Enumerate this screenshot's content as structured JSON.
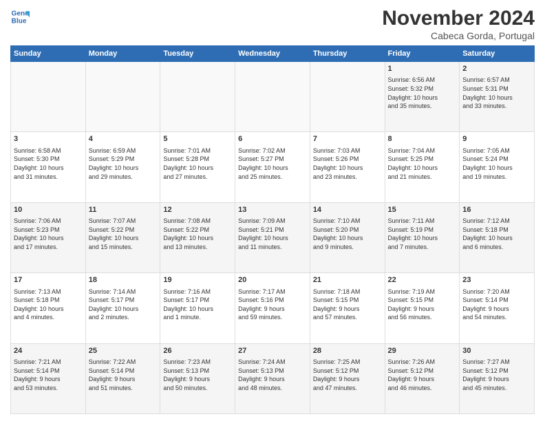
{
  "logo": {
    "line1": "General",
    "line2": "Blue"
  },
  "title": "November 2024",
  "location": "Cabeca Gorda, Portugal",
  "days_header": [
    "Sunday",
    "Monday",
    "Tuesday",
    "Wednesday",
    "Thursday",
    "Friday",
    "Saturday"
  ],
  "weeks": [
    [
      {
        "day": "",
        "data": ""
      },
      {
        "day": "",
        "data": ""
      },
      {
        "day": "",
        "data": ""
      },
      {
        "day": "",
        "data": ""
      },
      {
        "day": "",
        "data": ""
      },
      {
        "day": "1",
        "data": "Sunrise: 6:56 AM\nSunset: 5:32 PM\nDaylight: 10 hours\nand 35 minutes."
      },
      {
        "day": "2",
        "data": "Sunrise: 6:57 AM\nSunset: 5:31 PM\nDaylight: 10 hours\nand 33 minutes."
      }
    ],
    [
      {
        "day": "3",
        "data": "Sunrise: 6:58 AM\nSunset: 5:30 PM\nDaylight: 10 hours\nand 31 minutes."
      },
      {
        "day": "4",
        "data": "Sunrise: 6:59 AM\nSunset: 5:29 PM\nDaylight: 10 hours\nand 29 minutes."
      },
      {
        "day": "5",
        "data": "Sunrise: 7:01 AM\nSunset: 5:28 PM\nDaylight: 10 hours\nand 27 minutes."
      },
      {
        "day": "6",
        "data": "Sunrise: 7:02 AM\nSunset: 5:27 PM\nDaylight: 10 hours\nand 25 minutes."
      },
      {
        "day": "7",
        "data": "Sunrise: 7:03 AM\nSunset: 5:26 PM\nDaylight: 10 hours\nand 23 minutes."
      },
      {
        "day": "8",
        "data": "Sunrise: 7:04 AM\nSunset: 5:25 PM\nDaylight: 10 hours\nand 21 minutes."
      },
      {
        "day": "9",
        "data": "Sunrise: 7:05 AM\nSunset: 5:24 PM\nDaylight: 10 hours\nand 19 minutes."
      }
    ],
    [
      {
        "day": "10",
        "data": "Sunrise: 7:06 AM\nSunset: 5:23 PM\nDaylight: 10 hours\nand 17 minutes."
      },
      {
        "day": "11",
        "data": "Sunrise: 7:07 AM\nSunset: 5:22 PM\nDaylight: 10 hours\nand 15 minutes."
      },
      {
        "day": "12",
        "data": "Sunrise: 7:08 AM\nSunset: 5:22 PM\nDaylight: 10 hours\nand 13 minutes."
      },
      {
        "day": "13",
        "data": "Sunrise: 7:09 AM\nSunset: 5:21 PM\nDaylight: 10 hours\nand 11 minutes."
      },
      {
        "day": "14",
        "data": "Sunrise: 7:10 AM\nSunset: 5:20 PM\nDaylight: 10 hours\nand 9 minutes."
      },
      {
        "day": "15",
        "data": "Sunrise: 7:11 AM\nSunset: 5:19 PM\nDaylight: 10 hours\nand 7 minutes."
      },
      {
        "day": "16",
        "data": "Sunrise: 7:12 AM\nSunset: 5:18 PM\nDaylight: 10 hours\nand 6 minutes."
      }
    ],
    [
      {
        "day": "17",
        "data": "Sunrise: 7:13 AM\nSunset: 5:18 PM\nDaylight: 10 hours\nand 4 minutes."
      },
      {
        "day": "18",
        "data": "Sunrise: 7:14 AM\nSunset: 5:17 PM\nDaylight: 10 hours\nand 2 minutes."
      },
      {
        "day": "19",
        "data": "Sunrise: 7:16 AM\nSunset: 5:17 PM\nDaylight: 10 hours\nand 1 minute."
      },
      {
        "day": "20",
        "data": "Sunrise: 7:17 AM\nSunset: 5:16 PM\nDaylight: 9 hours\nand 59 minutes."
      },
      {
        "day": "21",
        "data": "Sunrise: 7:18 AM\nSunset: 5:15 PM\nDaylight: 9 hours\nand 57 minutes."
      },
      {
        "day": "22",
        "data": "Sunrise: 7:19 AM\nSunset: 5:15 PM\nDaylight: 9 hours\nand 56 minutes."
      },
      {
        "day": "23",
        "data": "Sunrise: 7:20 AM\nSunset: 5:14 PM\nDaylight: 9 hours\nand 54 minutes."
      }
    ],
    [
      {
        "day": "24",
        "data": "Sunrise: 7:21 AM\nSunset: 5:14 PM\nDaylight: 9 hours\nand 53 minutes."
      },
      {
        "day": "25",
        "data": "Sunrise: 7:22 AM\nSunset: 5:14 PM\nDaylight: 9 hours\nand 51 minutes."
      },
      {
        "day": "26",
        "data": "Sunrise: 7:23 AM\nSunset: 5:13 PM\nDaylight: 9 hours\nand 50 minutes."
      },
      {
        "day": "27",
        "data": "Sunrise: 7:24 AM\nSunset: 5:13 PM\nDaylight: 9 hours\nand 48 minutes."
      },
      {
        "day": "28",
        "data": "Sunrise: 7:25 AM\nSunset: 5:12 PM\nDaylight: 9 hours\nand 47 minutes."
      },
      {
        "day": "29",
        "data": "Sunrise: 7:26 AM\nSunset: 5:12 PM\nDaylight: 9 hours\nand 46 minutes."
      },
      {
        "day": "30",
        "data": "Sunrise: 7:27 AM\nSunset: 5:12 PM\nDaylight: 9 hours\nand 45 minutes."
      }
    ]
  ]
}
